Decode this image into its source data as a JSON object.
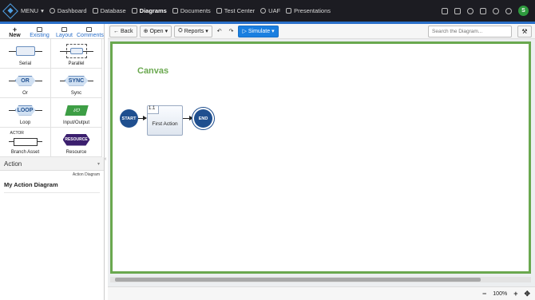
{
  "topnav": {
    "menu": "MENU",
    "items": [
      "Dashboard",
      "Database",
      "Diagrams",
      "Documents",
      "Test Center",
      "UAF",
      "Presentations"
    ],
    "active": "Diagrams",
    "avatar": "S"
  },
  "leftpanel": {
    "tabs": [
      "New",
      "Existing",
      "Layout",
      "Comments"
    ],
    "palette": [
      "Serial",
      "Parallel",
      "Or",
      "Sync",
      "Loop",
      "Input/Output",
      "Branch Asset",
      "Resource"
    ],
    "shape_text": {
      "or": "OR",
      "sync": "SYNC",
      "loop": "LOOP",
      "io": "I/O",
      "actor": "ACTOR",
      "resource": "RESOURCE"
    },
    "section_title": "Action",
    "diagram_type": "Action Diagram",
    "diagram_name": "My Action Diagram"
  },
  "toolbar": {
    "back": "Back",
    "open": "Open",
    "reports": "Reports",
    "simulate": "Simulate",
    "search_placeholder": "Search the Diagram..."
  },
  "canvas": {
    "label": "Canvas",
    "start": "START",
    "end": "END",
    "action_number": "1.1",
    "action_name": "First Action"
  },
  "bottombar": {
    "zoom": "100%"
  },
  "colors": {
    "accent": "#2a6fc9",
    "canvas_border": "#6aa84f",
    "node": "#1f4f8f",
    "simulate": "#1a7fe0"
  }
}
